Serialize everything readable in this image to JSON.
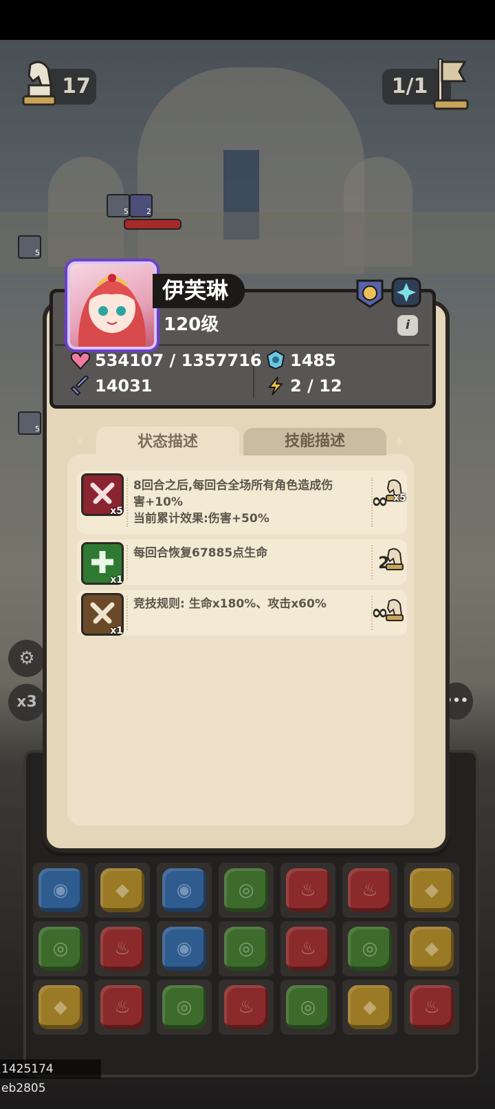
{
  "hud": {
    "turn_count": "17",
    "wave": "1/1"
  },
  "side_buttons": {
    "speed": "x3",
    "more": "•••"
  },
  "hero": {
    "name": "伊芙琳",
    "level": "120级",
    "hp": "534107 / 1357716",
    "defense": "1485",
    "attack": "14031",
    "energy": "2 / 12"
  },
  "tabs": {
    "status": "状态描述",
    "skills": "技能描述"
  },
  "effects": [
    {
      "line1": "8回合之后,每回合全场所有角色造成伤",
      "line2": "害+10%",
      "line3": "当前累计效果:伤害+50%",
      "stack": "x5",
      "duration_symbol": "∞",
      "duration_extra": "x5"
    },
    {
      "line1": "每回合恢复67885点生命",
      "stack": "x1",
      "duration": "2"
    },
    {
      "line1": "竞技规则: 生命x180%、攻击x60%",
      "stack": "x1",
      "duration_symbol": "∞"
    }
  ],
  "enemy_stacks": [
    "5",
    "2",
    "5",
    "5"
  ],
  "board": [
    [
      "blue",
      "yellow",
      "blue",
      "green",
      "red",
      "red",
      "yellow"
    ],
    [
      "green",
      "red",
      "blue",
      "green",
      "red",
      "green",
      "yellow"
    ],
    [
      "yellow",
      "red",
      "green",
      "red",
      "green",
      "yellow",
      "red"
    ]
  ],
  "colors": {
    "panel": "#e3d6b9",
    "header": "#585654",
    "portrait_frame": "#6c3fc7"
  },
  "footer": "1425174 eb2805"
}
